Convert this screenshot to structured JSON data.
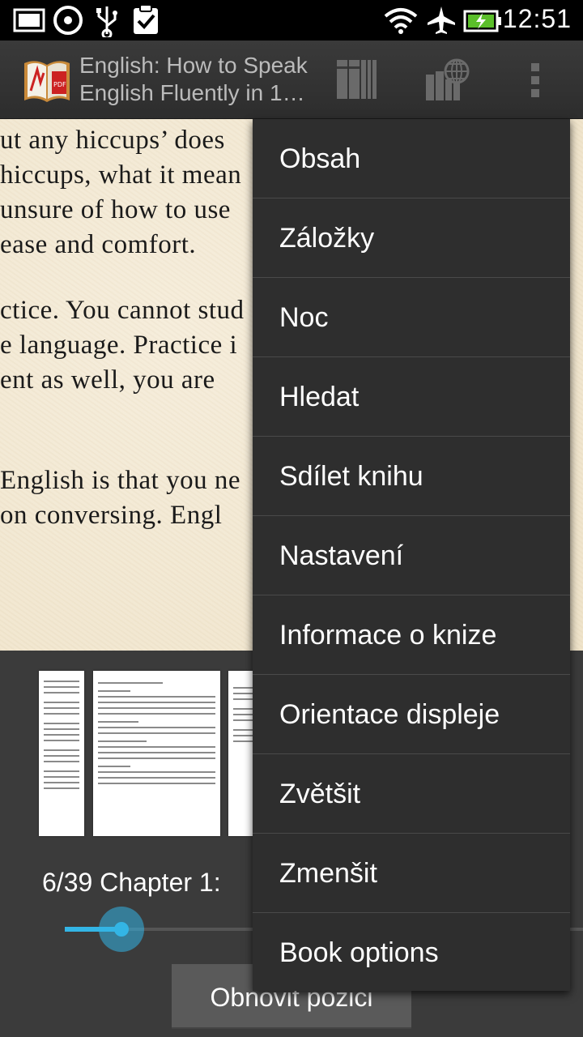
{
  "status_bar": {
    "time": "12:51",
    "icons": [
      "gallery-icon",
      "sync-icon",
      "usb-icon",
      "clipboard-check-icon",
      "wifi-icon",
      "airplane-mode-icon",
      "battery-charging-icon"
    ]
  },
  "action_bar": {
    "title_line1": "English: How to Speak",
    "title_line2": "English Fluently in 1…",
    "buttons": [
      "library-icon",
      "network-library-icon",
      "overflow-menu-icon"
    ]
  },
  "page_text": {
    "lines": [
      "ut any hiccups’ does",
      "hiccups, what it mean",
      " unsure of how to use",
      "ease and comfort.",
      "ctice. You cannot stud",
      "e language. Practice i",
      "ent as well, you are",
      "English is that you ne",
      "on  conversing.  Engl"
    ]
  },
  "bottom_panel": {
    "chapter_label": "6/39  Chapter 1:",
    "progress_fraction": 0.11,
    "restore_button": "Obnovit pozici"
  },
  "menu": {
    "items": [
      "Obsah",
      "Záložky",
      "Noc",
      "Hledat",
      "Sdílet knihu",
      "Nastavení",
      "Informace o knize",
      "Orientace displeje",
      "Zvětšit",
      "Zmenšit",
      "Book options"
    ]
  },
  "colors": {
    "accent": "#33b5e5",
    "page_bg": "#f2e8d2",
    "menu_bg": "#2e2e2e"
  }
}
